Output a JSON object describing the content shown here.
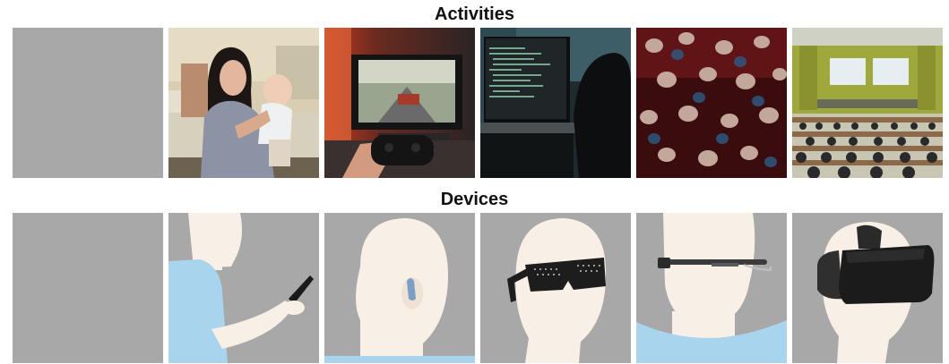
{
  "sections": {
    "activities": {
      "title": "Activities"
    },
    "devices": {
      "title": "Devices"
    }
  },
  "activities": [
    {
      "name": "blank"
    },
    {
      "name": "holding-baby"
    },
    {
      "name": "video-gaming"
    },
    {
      "name": "programming-laptop"
    },
    {
      "name": "crowd-party"
    },
    {
      "name": "lecture-hall"
    }
  ],
  "devices": [
    {
      "name": "blank"
    },
    {
      "name": "smartphone"
    },
    {
      "name": "hearing-aid"
    },
    {
      "name": "led-glasses"
    },
    {
      "name": "smart-glasses"
    },
    {
      "name": "vr-headset"
    }
  ],
  "colors": {
    "placeholder_gray": "#a8a8a8",
    "skin": "#f8efe6",
    "shirt": "#a8d4ee"
  }
}
